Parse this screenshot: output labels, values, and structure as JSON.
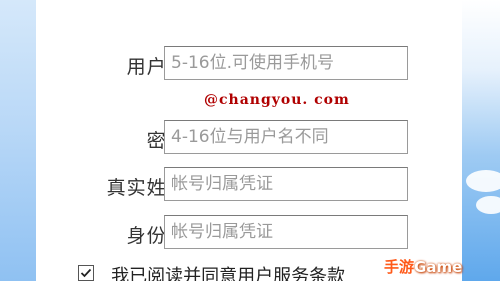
{
  "form": {
    "username": {
      "label": "用户名:",
      "placeholder": "5-16位.可使用手机号"
    },
    "email_hint": "@changyou. com",
    "password": {
      "label": "密码:",
      "placeholder": "4-16位与用户名不同"
    },
    "real_name": {
      "label": "真实姓名:",
      "placeholder": "帐号归属凭证"
    },
    "id_card": {
      "label": "身份证:",
      "placeholder": "帐号归属凭证"
    },
    "agreement": {
      "checked": true,
      "text_prefix": "我已阅读并同意",
      "link_text": "用户服务条款"
    }
  },
  "watermark": {
    "accent": "手游",
    "rest": "Game"
  },
  "colors": {
    "email_hint": "#b00000",
    "field_border": "#9a9a9a",
    "placeholder": "#9a9a9a",
    "watermark_accent": "#ff5a1a"
  }
}
